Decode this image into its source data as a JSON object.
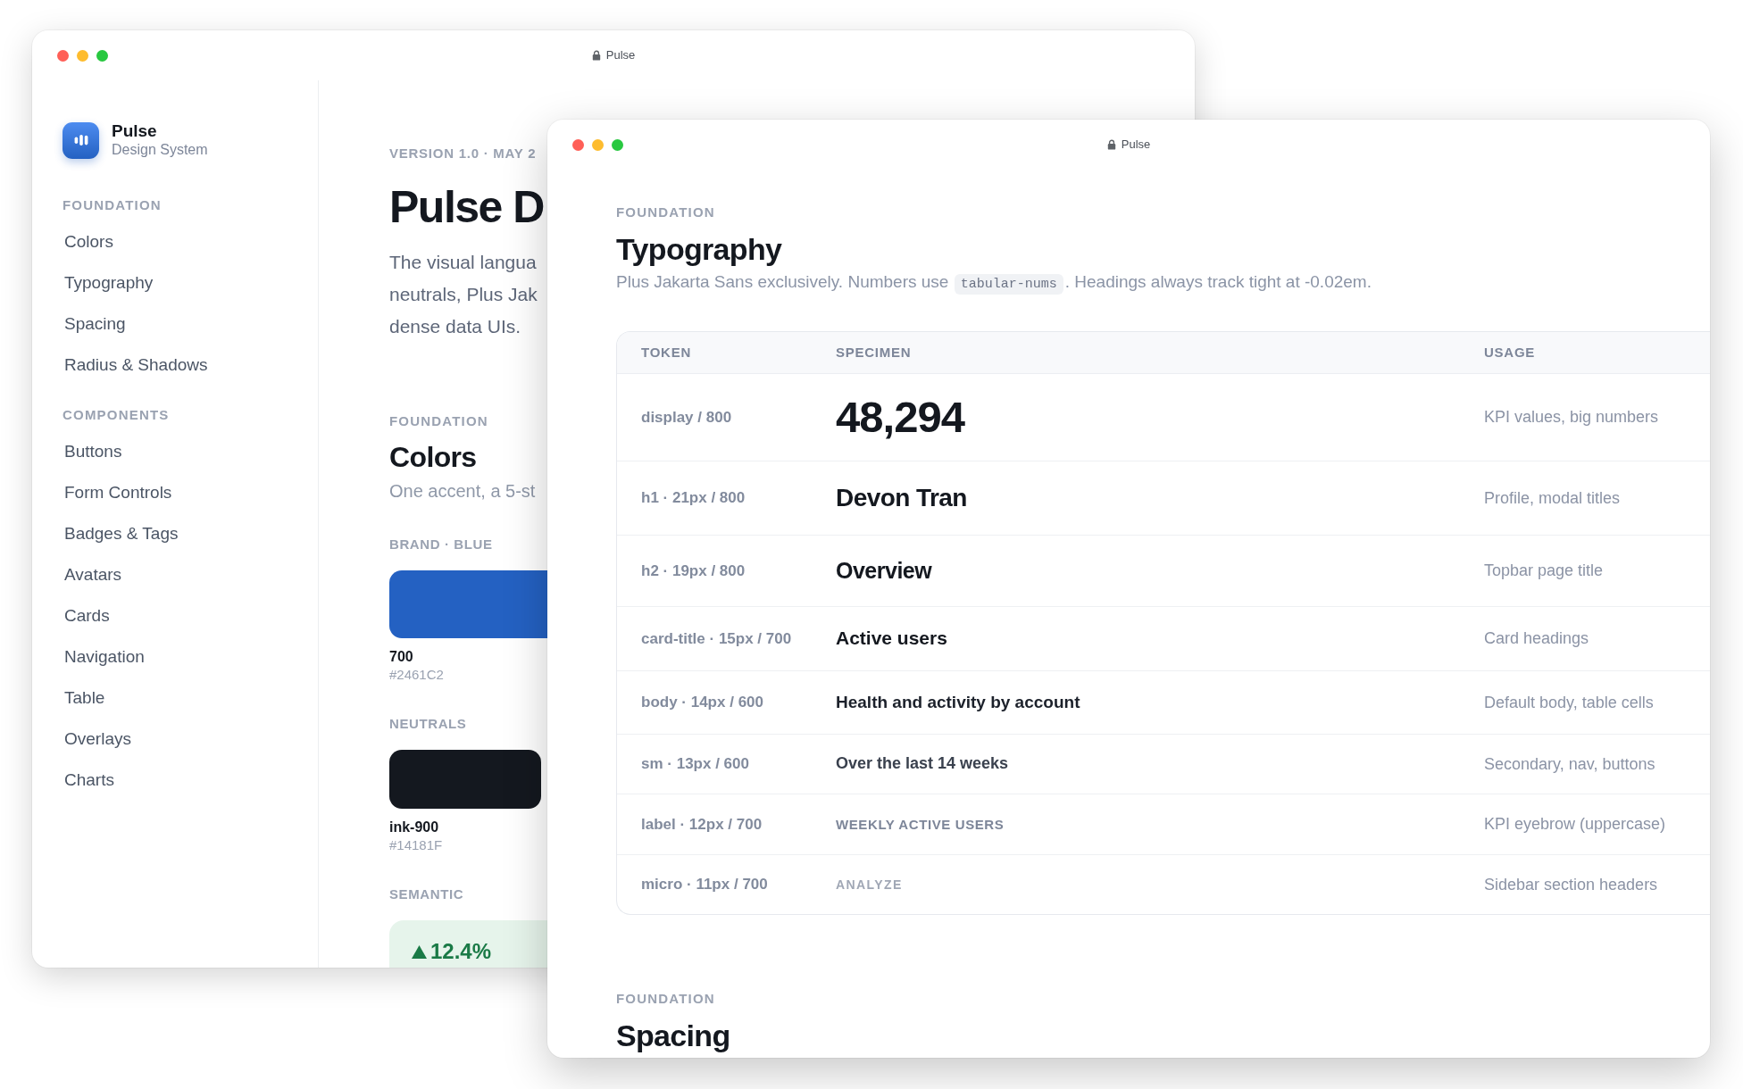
{
  "back_window": {
    "title": "Pulse",
    "sidebar": {
      "brand": {
        "name": "Pulse",
        "subtitle": "Design System"
      },
      "sections": [
        {
          "heading": "FOUNDATION",
          "items": [
            "Colors",
            "Typography",
            "Spacing",
            "Radius & Shadows"
          ]
        },
        {
          "heading": "COMPONENTS",
          "items": [
            "Buttons",
            "Form Controls",
            "Badges & Tags",
            "Avatars",
            "Cards",
            "Navigation",
            "Table",
            "Overlays",
            "Charts"
          ]
        }
      ]
    },
    "main": {
      "eyebrow": "VERSION 1.0 · MAY 2",
      "title": "Pulse D",
      "intro_lines": [
        "The visual langua",
        "neutrals, Plus Jak",
        "dense data UIs."
      ],
      "section": {
        "eyebrow": "FOUNDATION",
        "title": "Colors",
        "description": "One accent, a 5-st",
        "groups": [
          {
            "heading": "BRAND · BLUE",
            "kind": "bar",
            "name": "700",
            "hex": "#2461C2",
            "color": "#2461c2"
          },
          {
            "heading": "NEUTRALS",
            "kind": "tile",
            "name": "ink-900",
            "hex": "#14181F",
            "color": "#14181f"
          },
          {
            "heading": "SEMANTIC",
            "kind": "trend",
            "value": "12.4%",
            "rising": true
          }
        ]
      }
    }
  },
  "front_window": {
    "title": "Pulse",
    "sections": [
      {
        "eyebrow": "FOUNDATION",
        "title": "Typography",
        "description": [
          {
            "kind": "text",
            "text": "Plus Jakarta Sans exclusively. Numbers use "
          },
          {
            "kind": "code",
            "text": "tabular-nums"
          },
          {
            "kind": "text",
            "text": ". Headings always track tight at -0.02em."
          }
        ],
        "table": {
          "columns": [
            "TOKEN",
            "SPECIMEN",
            "USAGE"
          ],
          "rows": [
            {
              "kind": "display",
              "token": "display / 800",
              "specimen": "48,294",
              "usage": "KPI values, big numbers"
            },
            {
              "kind": "h1",
              "token": "h1 · 21px / 800",
              "specimen": "Devon Tran",
              "usage": "Profile, modal titles"
            },
            {
              "kind": "h2",
              "token": "h2 · 19px / 800",
              "specimen": "Overview",
              "usage": "Topbar page title"
            },
            {
              "kind": "card_title",
              "token": "card-title · 15px / 700",
              "specimen": "Active users",
              "usage": "Card headings"
            },
            {
              "kind": "body",
              "token": "body · 14px / 600",
              "specimen": "Health and activity by account",
              "usage": "Default body, table cells"
            },
            {
              "kind": "sm",
              "token": "sm · 13px / 600",
              "specimen": "Over the last 14 weeks",
              "usage": "Secondary, nav, buttons"
            },
            {
              "kind": "label",
              "token": "label · 12px / 700",
              "specimen": "WEEKLY ACTIVE USERS",
              "usage": "KPI eyebrow (uppercase)"
            },
            {
              "kind": "micro",
              "token": "micro · 11px / 700",
              "specimen": "ANALYZE",
              "usage": "Sidebar section headers"
            }
          ]
        }
      },
      {
        "eyebrow": "FOUNDATION",
        "title": "Spacing"
      }
    ]
  }
}
